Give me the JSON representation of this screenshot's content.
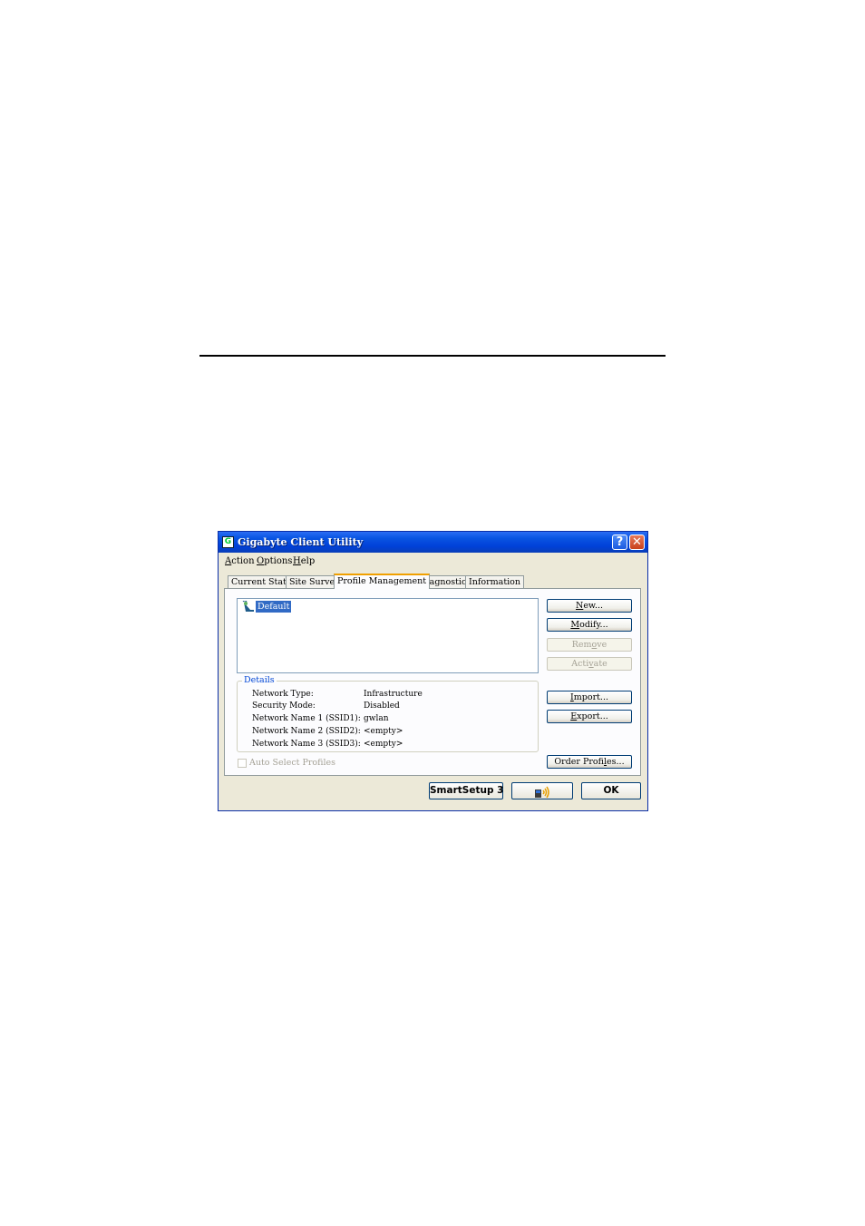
{
  "window": {
    "title": "Gigabyte Client Utility",
    "help_glyph": "?",
    "close_glyph": "✕"
  },
  "menu": [
    {
      "key": "A",
      "rest": "ction"
    },
    {
      "key": "O",
      "rest": "ptions"
    },
    {
      "key": "H",
      "rest": "elp"
    }
  ],
  "tabs": [
    "Current Status",
    "Site Survey",
    "Profile Management",
    "Diagnostics",
    "Information"
  ],
  "active_tab": "Profile Management",
  "profiles": [
    "Default"
  ],
  "buttons": {
    "new": {
      "key": "N",
      "rest": "ew..."
    },
    "modify": {
      "key": "M",
      "rest": "odify..."
    },
    "remove": {
      "pre": "Rem",
      "key": "o",
      "rest": "ve"
    },
    "activate": {
      "pre": "Acti",
      "key": "v",
      "rest": "ate"
    },
    "import": {
      "key": "I",
      "rest": "mport..."
    },
    "export": {
      "key": "E",
      "rest": "xport..."
    },
    "order": {
      "pre": "Order Profi",
      "key": "l",
      "rest": "es..."
    }
  },
  "details": {
    "legend": "Details",
    "rows": [
      {
        "label": "Network Type:",
        "value": "Infrastructure"
      },
      {
        "label": "Security Mode:",
        "value": "Disabled"
      },
      {
        "label": "Network Name 1 (SSID1):",
        "value": "gwlan"
      },
      {
        "label": "Network Name 2 (SSID2):",
        "value": "<empty>"
      },
      {
        "label": "Network Name 3 (SSID3):",
        "value": "<empty>"
      }
    ]
  },
  "auto_select": {
    "label": "Auto Select Profiles",
    "checked": false
  },
  "footer": {
    "smartsetup_label": "SmartSetup 3",
    "wireless_icon": "wireless-card-icon",
    "ok_label": "OK"
  },
  "colors": {
    "titlebar": "#0a55e2",
    "selection": "#316ac5",
    "active_tab_accent": "#f0a000",
    "legend_text": "#0046d5"
  }
}
